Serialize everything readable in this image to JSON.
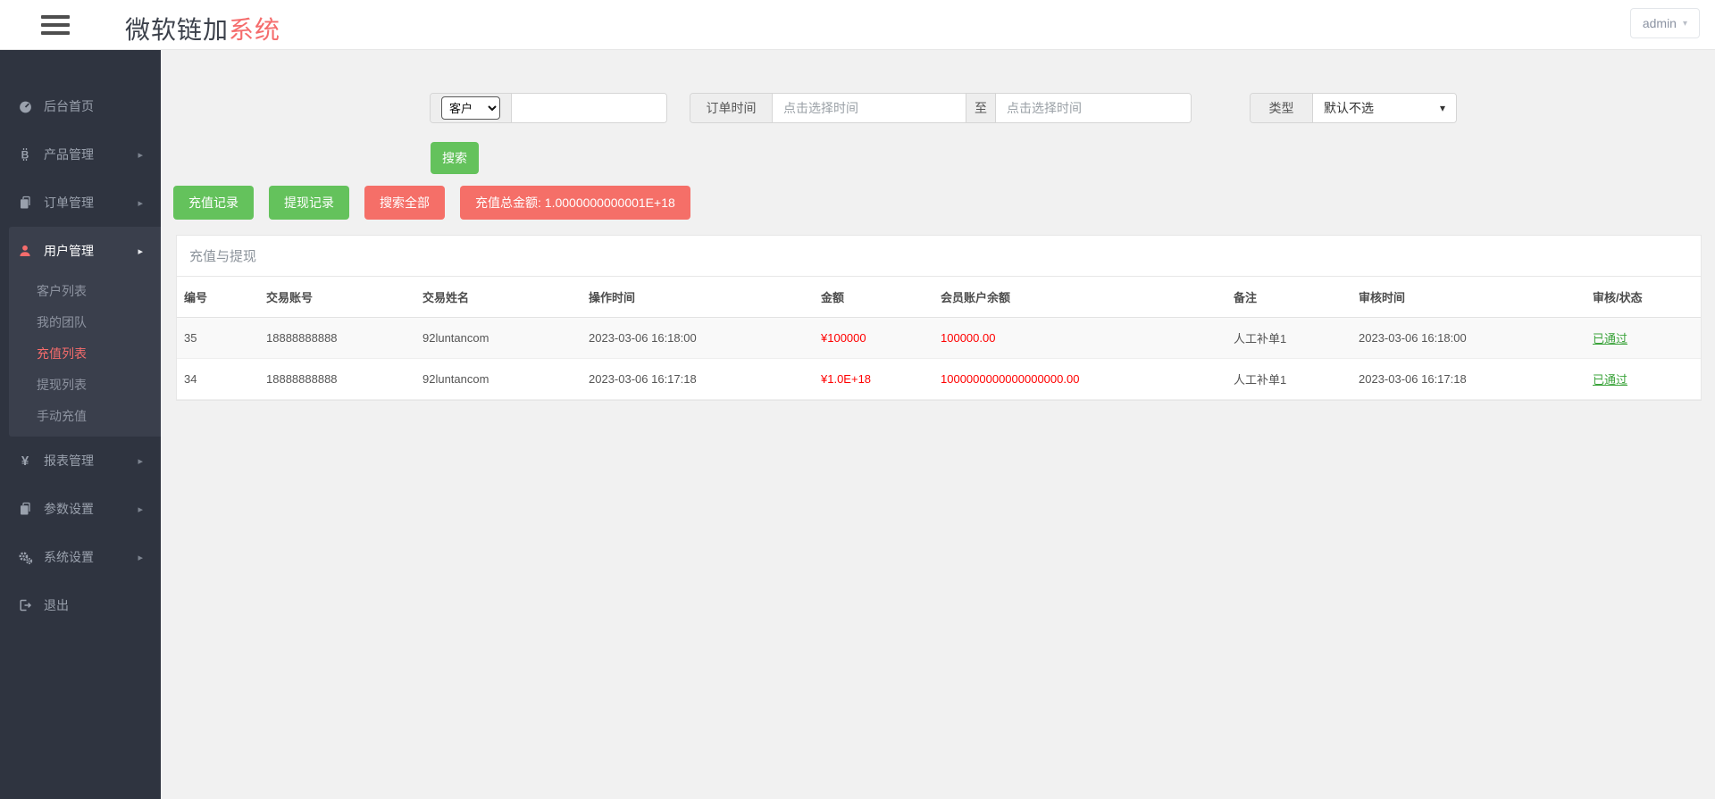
{
  "colors": {
    "accent_red": "#f56c6c",
    "success_green": "#64c25c",
    "danger_button": "#f56f68",
    "danger_text": "#ff0000",
    "status_green": "#3aa33a",
    "sidebar_bg": "#2f3440"
  },
  "icons": {
    "chevron_right": "▸",
    "caret_down": "▾",
    "yen": "¥"
  },
  "header": {
    "brand_main": "微软链加",
    "brand_accent": "系统",
    "user_label": "admin"
  },
  "sidebar": {
    "items": [
      {
        "label": "后台首页"
      },
      {
        "label": "产品管理"
      },
      {
        "label": "订单管理"
      },
      {
        "label": "用户管理",
        "children": [
          "客户列表",
          "我的团队",
          "充值列表",
          "提现列表",
          "手动充值"
        ],
        "active_child": "充值列表"
      },
      {
        "label": "报表管理"
      },
      {
        "label": "参数设置"
      },
      {
        "label": "系统设置"
      },
      {
        "label": "退出"
      }
    ]
  },
  "filters": {
    "field_select_value": "客户",
    "keyword_value": "",
    "order_time_label": "订单时间",
    "date_from_placeholder": "点击选择时间",
    "to_label": "至",
    "date_to_placeholder": "点击选择时间",
    "type_label": "类型",
    "type_select_value": "默认不选",
    "search_button": "搜索"
  },
  "actions": {
    "recharge_records": "充值记录",
    "withdraw_records": "提现记录",
    "search_all": "搜索全部",
    "recharge_total": "充值总金额: 1.0000000000001E+18"
  },
  "panel": {
    "title": "充值与提现",
    "table": {
      "headers": [
        "编号",
        "交易账号",
        "交易姓名",
        "操作时间",
        "金额",
        "会员账户余额",
        "备注",
        "审核时间",
        "审核/状态"
      ],
      "rows": [
        {
          "id": "35",
          "account": "18888888888",
          "name": "92luntancom",
          "op_time": "2023-03-06 16:18:00",
          "amount": "¥100000",
          "balance": "100000.00",
          "remark": "人工补单1",
          "audit_time": "2023-03-06 16:18:00",
          "status": "已通过"
        },
        {
          "id": "34",
          "account": "18888888888",
          "name": "92luntancom",
          "op_time": "2023-03-06 16:17:18",
          "amount": "¥1.0E+18",
          "balance": "1000000000000000000.00",
          "remark": "人工补单1",
          "audit_time": "2023-03-06 16:17:18",
          "status": "已通过"
        }
      ]
    }
  }
}
